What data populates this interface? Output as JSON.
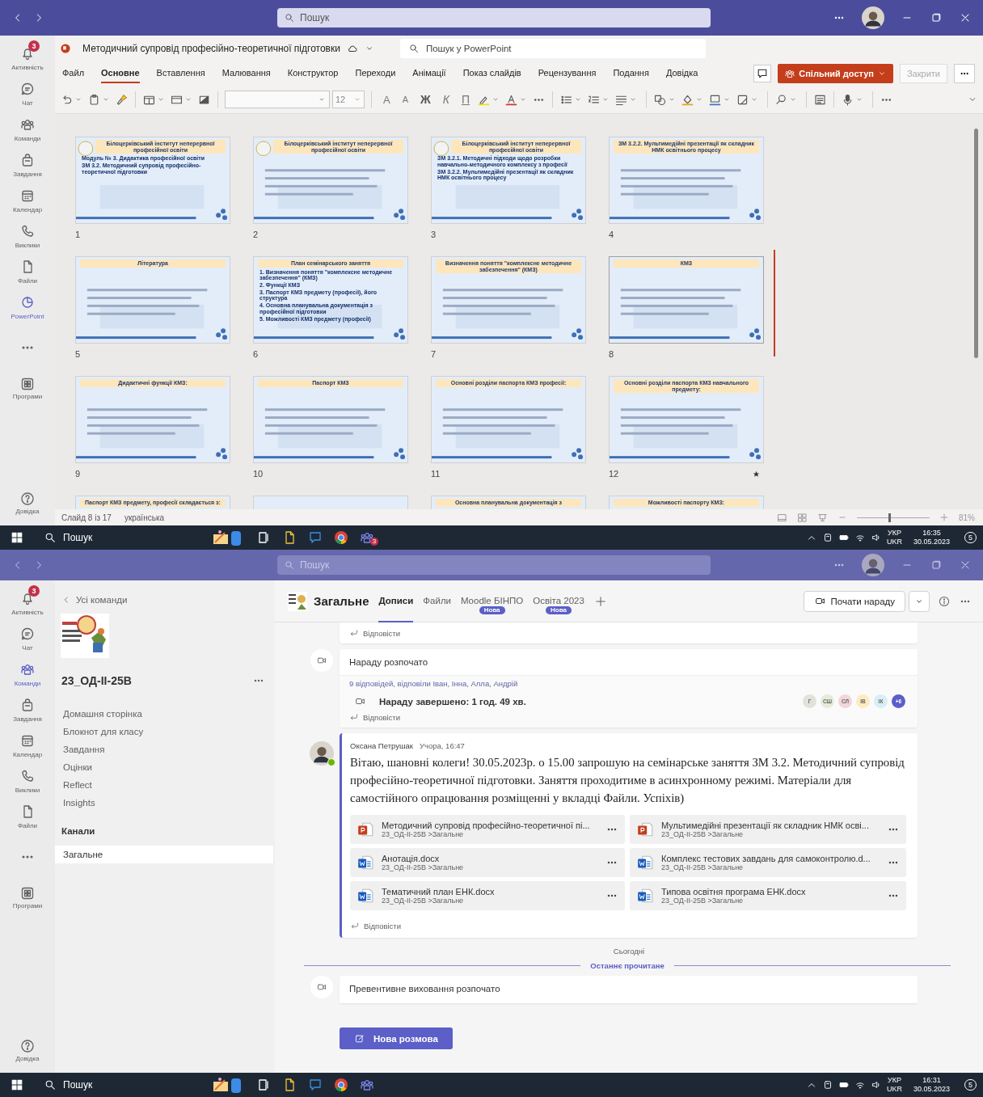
{
  "top_window": {
    "title_bar": {
      "search_placeholder": "Пошук"
    },
    "rail": [
      {
        "label": "Активність",
        "badge": "3",
        "selected": false
      },
      {
        "label": "Чат",
        "selected": false
      },
      {
        "label": "Команди",
        "selected": false
      },
      {
        "label": "Завдання",
        "selected": false
      },
      {
        "label": "Календар",
        "selected": false
      },
      {
        "label": "Виклики",
        "selected": false
      },
      {
        "label": "Файли",
        "selected": false
      },
      {
        "label": "PowerPoint",
        "selected": true
      }
    ],
    "rail_apps": "Програми",
    "rail_help": "Довідка",
    "document": {
      "title": "Методичний супровід професійно-теоретичної підготовки",
      "search_placeholder": "Пошук у PowerPoint"
    },
    "ribbon_tabs": [
      {
        "label": "Файл",
        "selected": false
      },
      {
        "label": "Основне",
        "selected": true
      },
      {
        "label": "Вставлення",
        "selected": false
      },
      {
        "label": "Малювання",
        "selected": false
      },
      {
        "label": "Конструктор",
        "selected": false
      },
      {
        "label": "Переходи",
        "selected": false
      },
      {
        "label": "Анімації",
        "selected": false
      },
      {
        "label": "Показ слайдів",
        "selected": false
      },
      {
        "label": "Рецензування",
        "selected": false
      },
      {
        "label": "Подання",
        "selected": false
      },
      {
        "label": "Довідка",
        "selected": false
      }
    ],
    "share_button": "Спільний доступ",
    "close_button": "Закрити",
    "toolbar": {
      "font_size": "12",
      "grow": "A",
      "shrink": "A",
      "bold": "Ж",
      "italic": "К",
      "underline": "П"
    },
    "slides": [
      {
        "number": "1",
        "header": [
          "Білоцерківський інститут неперервної професійної освіти"
        ],
        "body": [
          "Модуль № 3. Дидактика професійної освіти",
          "ЗМ 3.2. Методичний супровід професійно-теоретичної підготовки"
        ],
        "selected": false
      },
      {
        "number": "2",
        "header": [
          "Білоцерківський інститут неперервної професійної освіти"
        ],
        "selected": false
      },
      {
        "number": "3",
        "header": [
          "Білоцерківський інститут неперервної професійної освіти"
        ],
        "body": [
          "ЗМ 3.2.1. Методичні підходи щодо розробки навчально-методичного комплексу з професії",
          "ЗМ 3.2.2. Мультимедійні презентації як складник НМК освітнього процесу"
        ],
        "selected": false
      },
      {
        "number": "4",
        "header": [
          "ЗМ 3.2.2. Мультимедійні презентації як складник НМК освітнього процесу"
        ],
        "selected": false
      },
      {
        "number": "5",
        "header": [
          "Література"
        ],
        "selected": false
      },
      {
        "number": "6",
        "header": [
          "План семінарського заняття"
        ],
        "body": [
          "1. Визначення поняття \"комплексне методичне забезпечення\" (КМЗ)",
          "2. Функції КМЗ",
          "3. Паспорт КМЗ предмету (професії), його структура",
          "4. Основна планувальна документація з професійної підготовки",
          "5. Можливості КМЗ предмету (професії)"
        ],
        "selected": false
      },
      {
        "number": "7",
        "header": [
          "Визначення поняття \"комплексне методичне забезпечення\" (КМЗ)"
        ],
        "selected": false
      },
      {
        "number": "8",
        "header": [
          "КМЗ"
        ],
        "selected": true
      },
      {
        "number": "9",
        "header": [
          "Дидактичні функції КМЗ:"
        ],
        "selected": false
      },
      {
        "number": "10",
        "header": [
          "Паспорт КМЗ"
        ],
        "selected": false
      },
      {
        "number": "11",
        "header": [
          "Основні розділи паспорта КМЗ професії:"
        ],
        "selected": false
      },
      {
        "number": "12",
        "header": [
          "Основні розділи паспорта КМЗ навчального предмету:"
        ],
        "selected": false,
        "animated": true
      },
      {
        "header": [
          "Паспорт КМЗ предмету, професії складається з:"
        ],
        "selected": false
      },
      {
        "selected": false
      },
      {
        "header": [
          "Основна планувальна документація з"
        ],
        "selected": false
      },
      {
        "header": [
          "Можливості паспорту КМЗ:"
        ],
        "selected": false
      }
    ],
    "status_bar": {
      "slide": "Слайд 8 із 17",
      "language": "українська",
      "zoom": "81%",
      "zoom_slider": {
        "level": 0.45
      }
    },
    "taskbar": {
      "search": "Пошук",
      "teams_badge": "3",
      "lang_top": "УКР",
      "lang_bottom": "UKR",
      "time": "16:35",
      "date": "30.05.2023",
      "notifications": "5"
    }
  },
  "bottom_window": {
    "title_bar": {
      "search_placeholder": "Пошук"
    },
    "rail": [
      {
        "label": "Активність",
        "badge": "3",
        "selected": false
      },
      {
        "label": "Чат",
        "selected": false
      },
      {
        "label": "Команди",
        "selected": true
      },
      {
        "label": "Завдання",
        "selected": false
      },
      {
        "label": "Календар",
        "selected": false
      },
      {
        "label": "Виклики",
        "selected": false
      },
      {
        "label": "Файли",
        "selected": false
      }
    ],
    "rail_apps": "Програми",
    "rail_help": "Довідка",
    "teams_panel": {
      "back": "Усі команди",
      "team_name": "23_ОД-ІІ-25В",
      "nav": [
        "Домашня сторінка",
        "Блокнот для класу",
        "Завдання",
        "Оцінки",
        "Reflect",
        "Insights"
      ],
      "channels_heading": "Канали",
      "channels": [
        {
          "name": "Загальне",
          "selected": true
        }
      ]
    },
    "channel_header": {
      "name": "Загальне",
      "tabs": [
        {
          "label": "Дописи",
          "selected": true
        },
        {
          "label": "Файли",
          "selected": false
        },
        {
          "label": "Moodle БІНПО",
          "badge": "Нова",
          "selected": false
        },
        {
          "label": "Освіта 2023",
          "badge": "Нова",
          "selected": false
        }
      ],
      "meet_button": "Почати нараду"
    },
    "feed": [
      {
        "kind": "reply-stub",
        "reply": "Відповісти"
      },
      {
        "kind": "meeting",
        "title": "Нараду розпочато",
        "replies_summary": "9 відповідей, відповіли Іван, Інна, Алла, Андрій",
        "ended": "Нараду завершено: 1 год. 49 хв.",
        "participants": [
          {
            "text": "Г",
            "color": "#dfe3da"
          },
          {
            "text": "СШ",
            "color": "#e4ecd9"
          },
          {
            "text": "СЛ",
            "color": "#f3d6da"
          },
          {
            "text": "ІВ",
            "color": "#fcebc0"
          },
          {
            "text": "ІК",
            "color": "#d7eef5"
          },
          {
            "text": "+6",
            "color": "#5b5fc7"
          }
        ],
        "reply": "Відповісти"
      },
      {
        "kind": "post",
        "author": "Оксана Петрушак",
        "time": "Учора, 16:47",
        "text": "Вітаю, шановні колеги! 30.05.2023р. о 15.00 запрошую на семінарське заняття ЗМ 3.2. Методичний супровід професійно-теоретичної підготовки. Заняття проходитиме в асинхронному режимі. Матеріали для самостійного опрацювання розміщенні у вкладці Файли. Успіхів)",
        "attachments": [
          {
            "kind": "ppt",
            "name": "Методичний супровід професійно-теоретичної пі...",
            "path": "23_ОД-ІІ-25В >Загальне"
          },
          {
            "kind": "ppt",
            "name": "Мультимедійні презентації як складник НМК осві...",
            "path": "23_ОД-ІІ-25В >Загальне"
          },
          {
            "kind": "word",
            "name": "Анотація.docx",
            "path": "23_ОД-ІІ-25В >Загальне"
          },
          {
            "kind": "word",
            "name": "Комплекс тестових завдань для самоконтролю.d...",
            "path": "23_ОД-ІІ-25В >Загальне"
          },
          {
            "kind": "word",
            "name": "Тематичний план ЕНК.docx",
            "path": "23_ОД-ІІ-25В >Загальне"
          },
          {
            "kind": "word",
            "name": "Типова освітня програма ЕНК.docx",
            "path": "23_ОД-ІІ-25В >Загальне"
          }
        ],
        "reply": "Відповісти"
      },
      {
        "kind": "date-divider",
        "text": "Сьогодні"
      },
      {
        "kind": "read-divider",
        "text": "Останнє прочитане"
      },
      {
        "kind": "meeting-start",
        "title": "Превентивне виховання розпочато"
      }
    ],
    "new_conversation": "Нова розмова",
    "taskbar": {
      "search": "Пошук",
      "lang_top": "УКР",
      "lang_bottom": "UKR",
      "time": "16:31",
      "date": "30.05.2023",
      "notifications": "5"
    }
  }
}
